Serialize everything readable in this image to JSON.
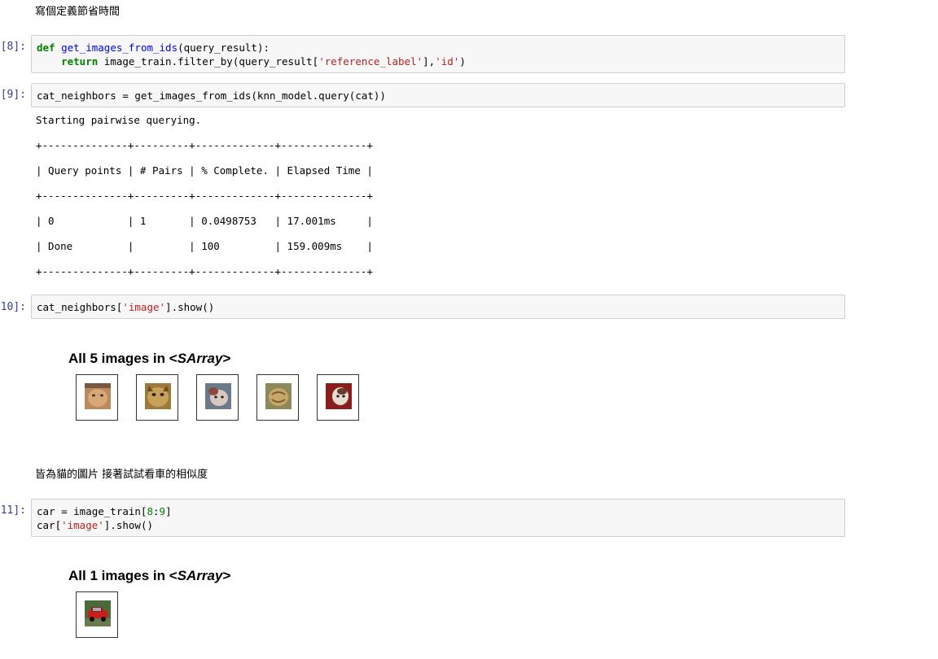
{
  "md1": "寫個定義節省時間",
  "cells": [
    {
      "prompt": "[8]:",
      "line1_kw": "def",
      "line1_fn": "get_images_from_ids",
      "line1_rest": "(query_result):",
      "line2_kw": "return",
      "line2_a": " image_train.filter_by(query_result[",
      "line2_s1": "'reference_label'",
      "line2_b": "],",
      "line2_s2": "'id'",
      "line2_c": ")"
    },
    {
      "prompt": "[9]:",
      "code": "cat_neighbors = get_images_from_ids(knn_model.query(cat))"
    },
    {
      "prompt": "10]:",
      "code_a": "cat_neighbors[",
      "code_s": "'image'",
      "code_b": "].show()"
    },
    {
      "prompt": "11]:",
      "l1_a": "car = image_train[",
      "l1_n1": "8",
      "l1_b": ":",
      "l1_n2": "9",
      "l1_c": "]",
      "l2_a": "car[",
      "l2_s": "'image'",
      "l2_b": "].show()"
    }
  ],
  "output": {
    "line1": "Starting pairwise querying.",
    "sep": "+--------------+---------+-------------+--------------+",
    "header": "| Query points | # Pairs | % Complete. | Elapsed Time |",
    "row1": "| 0            | 1       | 0.0498753   | 17.001ms     |",
    "row2": "| Done         |         | 100         | 159.009ms    |"
  },
  "sarray1": {
    "prefix": "All 5 images in <",
    "type": "SArray",
    "suffix": ">"
  },
  "md2": "皆為貓的圖片 接著試試看車的相似度",
  "sarray2": {
    "prefix": "All 1 images in <",
    "type": "SArray",
    "suffix": ">"
  },
  "thumbs_cat": [
    "cat-image-1",
    "cat-image-2",
    "cat-image-3",
    "cat-image-4",
    "cat-image-5"
  ],
  "thumbs_car": [
    "car-image-1"
  ]
}
